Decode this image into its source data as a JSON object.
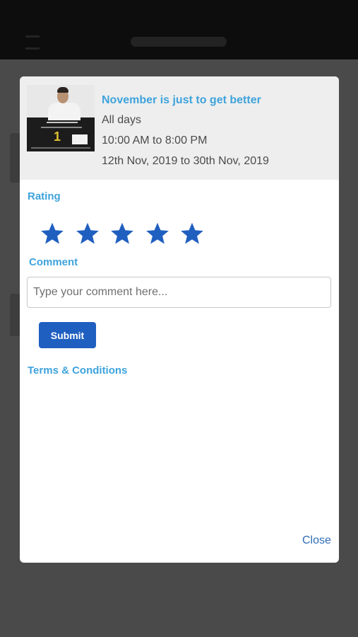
{
  "colors": {
    "accent": "#3ea3dc",
    "primary_button": "#1f5fc0",
    "star": "#1f5fc0",
    "link": "#2f6db5",
    "header_bg": "#eeeeee",
    "overlay_bg": "#4a4a4a"
  },
  "event": {
    "image_icon": "promo-poster-image",
    "title": "November is just to get better",
    "days": "All days",
    "time": "10:00 AM to 8:00 PM",
    "dates": "12th Nov, 2019 to 30th Nov, 2019"
  },
  "rating": {
    "label": "Rating",
    "max": 5,
    "value": 5,
    "star_icon": "star-icon"
  },
  "comment": {
    "label": "Comment",
    "placeholder": "Type your comment here...",
    "value": ""
  },
  "actions": {
    "submit_label": "Submit",
    "terms_label": "Terms & Conditions",
    "close_label": "Close"
  }
}
